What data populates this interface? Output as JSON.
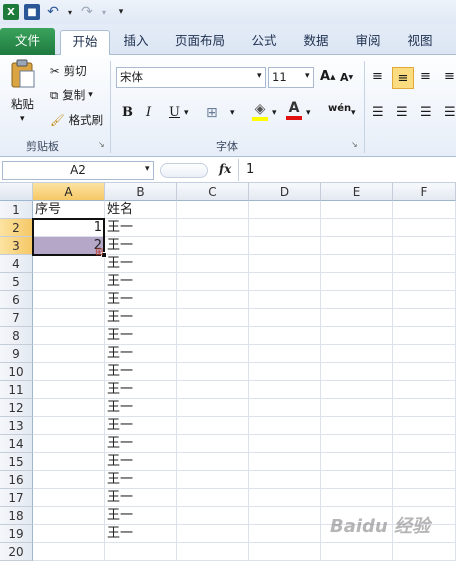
{
  "qat": {
    "icons": [
      "excel-logo",
      "save-icon",
      "undo-icon",
      "redo-icon",
      "customize-icon"
    ]
  },
  "tabs": [
    {
      "label": "文件"
    },
    {
      "label": "开始"
    },
    {
      "label": "插入"
    },
    {
      "label": "页面布局"
    },
    {
      "label": "公式"
    },
    {
      "label": "数据"
    },
    {
      "label": "审阅"
    },
    {
      "label": "视图"
    }
  ],
  "ribbon": {
    "clipboard": {
      "paste": "粘贴",
      "cut": "剪切",
      "copy": "复制",
      "format_painter": "格式刷",
      "group_label": "剪贴板"
    },
    "font": {
      "name": "宋体",
      "size": "11",
      "group_label": "字体",
      "bold": "B",
      "italic": "I",
      "underline": "U"
    }
  },
  "formula_bar": {
    "name_box": "A2",
    "fx": "fx",
    "value": "1"
  },
  "columns": [
    "A",
    "B",
    "C",
    "D",
    "E",
    "F"
  ],
  "rows": [
    "1",
    "2",
    "3",
    "4",
    "5",
    "6",
    "7",
    "8",
    "9",
    "10",
    "11",
    "12",
    "13",
    "14",
    "15",
    "16",
    "17",
    "18",
    "19",
    "20"
  ],
  "cells": {
    "A1": "序号",
    "B1": "姓名",
    "A2": "1",
    "A3": "2",
    "B_values": [
      "王一",
      "王一",
      "王一",
      "王一",
      "王一",
      "王一",
      "王一",
      "王一",
      "王一",
      "王一",
      "王一",
      "王一",
      "王一",
      "王一",
      "王一",
      "王一",
      "王一",
      "王一"
    ]
  },
  "watermark": "Baidu 经验",
  "colors": {
    "selection": "#b4a7c8",
    "header_highlight": "#f6c866",
    "file_tab": "#1f7a3f"
  }
}
